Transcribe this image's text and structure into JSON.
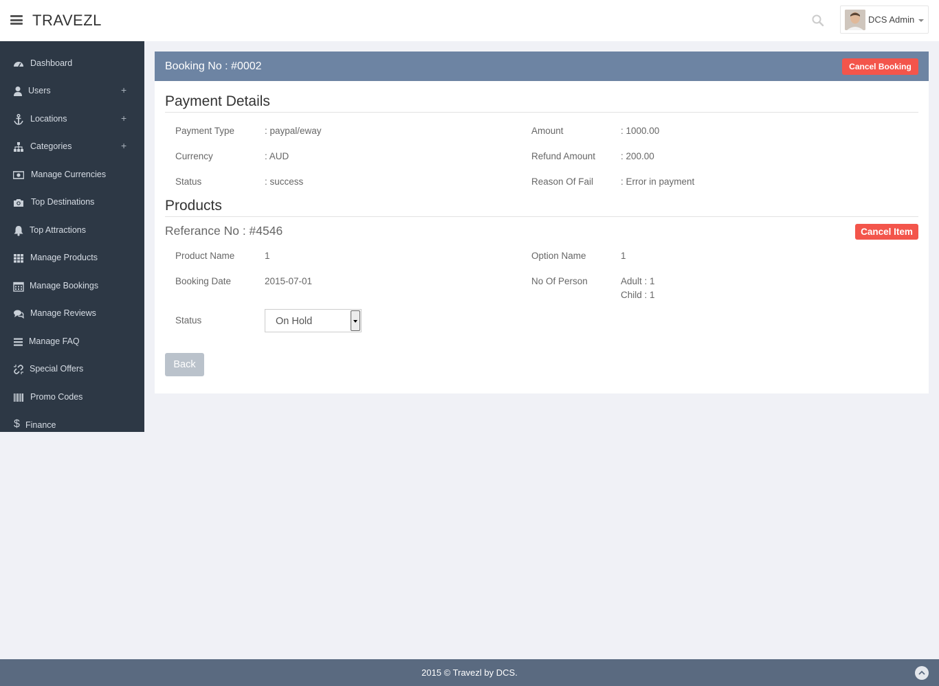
{
  "header": {
    "brand": "TRAVEZL",
    "user_name": "DCS Admin"
  },
  "sidebar": {
    "items": [
      {
        "label": "Dashboard",
        "icon": "dashboard-icon",
        "expandable": false
      },
      {
        "label": "Users",
        "icon": "user-icon",
        "expandable": true
      },
      {
        "label": "Locations",
        "icon": "anchor-icon",
        "expandable": true
      },
      {
        "label": "Categories",
        "icon": "sitemap-icon",
        "expandable": true
      },
      {
        "label": "Manage Currencies",
        "icon": "money-icon",
        "expandable": false
      },
      {
        "label": "Top Destinations",
        "icon": "camera-icon",
        "expandable": false
      },
      {
        "label": "Top Attractions",
        "icon": "bell-icon",
        "expandable": false
      },
      {
        "label": "Manage Products",
        "icon": "grid-icon",
        "expandable": false
      },
      {
        "label": "Manage Bookings",
        "icon": "calendar-icon",
        "expandable": false
      },
      {
        "label": "Manage Reviews",
        "icon": "comments-icon",
        "expandable": false
      },
      {
        "label": "Manage FAQ",
        "icon": "list-icon",
        "expandable": false
      },
      {
        "label": "Special Offers",
        "icon": "unlink-icon",
        "expandable": false
      },
      {
        "label": "Promo Codes",
        "icon": "barcode-icon",
        "expandable": false
      },
      {
        "label": "Finance",
        "icon": "dollar-icon",
        "expandable": false
      }
    ],
    "plus_symbol": "+"
  },
  "booking": {
    "title": "Booking No : #0002",
    "cancel_label": "Cancel Booking"
  },
  "payment": {
    "section_title": "Payment Details",
    "payment_type_label": "Payment Type",
    "payment_type_value": ": paypal/eway",
    "currency_label": "Currency",
    "currency_value": ": AUD",
    "status_label": "Status",
    "status_value": ": success",
    "amount_label": "Amount",
    "amount_value": ": 1000.00",
    "refund_label": "Refund Amount",
    "refund_value": ": 200.00",
    "reason_label": "Reason Of Fail",
    "reason_value": ": Error in payment"
  },
  "products": {
    "section_title": "Products",
    "reference_title": "Referance No : #4546",
    "cancel_item_label": "Cancel Item",
    "product_name_label": "Product Name",
    "product_name_value": "1",
    "booking_date_label": "Booking Date",
    "booking_date_value": "2015-07-01",
    "status_label": "Status",
    "status_selected": "On Hold",
    "option_name_label": "Option Name",
    "option_name_value": "1",
    "persons_label": "No Of Person",
    "adult_value": "Adult : 1",
    "child_value": "Child : 1",
    "back_label": "Back"
  },
  "footer": {
    "text": "2015 © Travezl by DCS."
  },
  "colors": {
    "sidebar_bg": "#2d3845",
    "panel_header": "#6d84a3",
    "danger": "#f3554b",
    "footer_bg": "#5a6a80"
  }
}
